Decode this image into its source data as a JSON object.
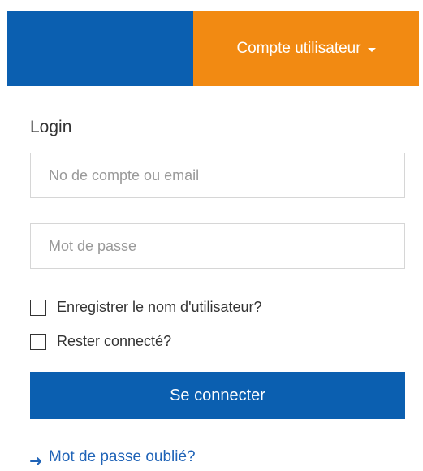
{
  "header": {
    "account_menu_label": "Compte utilisateur"
  },
  "login": {
    "title": "Login",
    "username_placeholder": "No de compte ou email",
    "password_placeholder": "Mot de passe",
    "remember_username_label": "Enregistrer le nom d'utilisateur?",
    "stay_connected_label": "Rester connecté?",
    "submit_label": "Se connecter",
    "forgot_password_label": "Mot de passe oublié?"
  },
  "icons": {
    "account_menu": "chevron-down-icon",
    "forgot_password": "arrow-right-icon"
  },
  "colors": {
    "brand_blue": "#0b5fb0",
    "accent_orange": "#f28a12",
    "link_blue": "#1f63b7"
  }
}
